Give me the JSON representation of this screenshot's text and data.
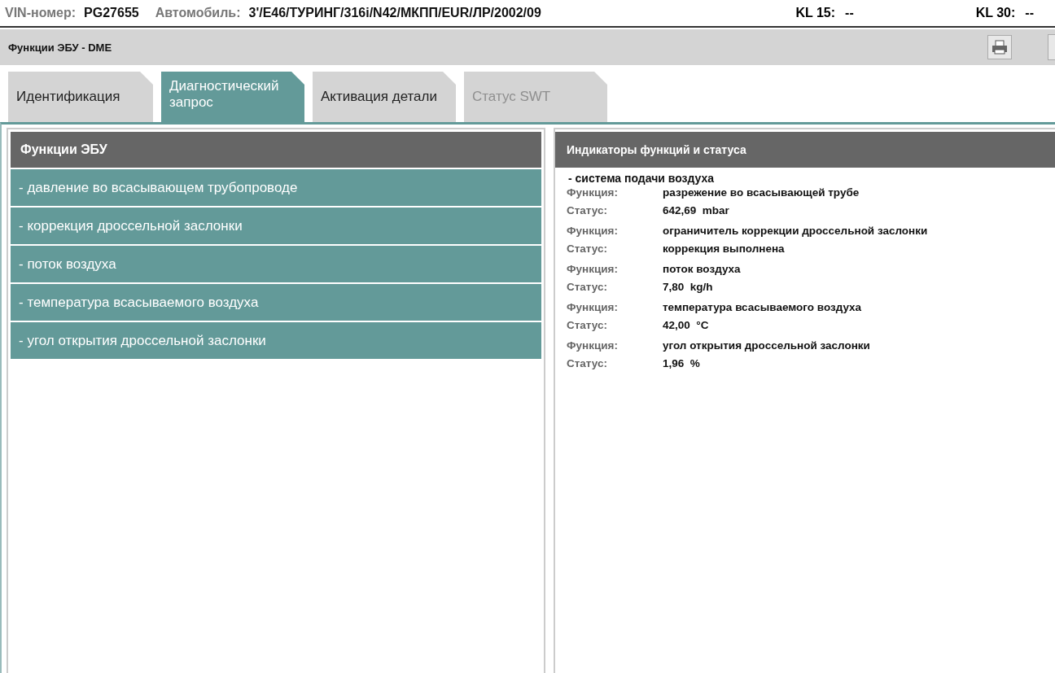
{
  "vehicle_bar": {
    "vin_label": "VIN-номер:",
    "vin": "PG27655",
    "car_label": "Автомобиль:",
    "car": "3'/E46/ТУРИНГ/316i/N42/МКПП/EUR/ЛР/2002/09",
    "kl15_label": "KL 15:",
    "kl15": "--",
    "kl30_label": "KL 30:",
    "kl30": "--"
  },
  "title_bar": {
    "title": "Функции ЭБУ - DME"
  },
  "tabs": [
    {
      "label": "Идентификация",
      "selected": false,
      "disabled": false
    },
    {
      "label": "Диагностический запрос",
      "selected": true,
      "disabled": false
    },
    {
      "label": "Активация детали",
      "selected": false,
      "disabled": false
    },
    {
      "label": "Статус SWT",
      "selected": false,
      "disabled": true
    }
  ],
  "functions_panel": {
    "title": "Функции ЭБУ",
    "items": [
      {
        "label": "- давление во всасывающем трубопроводе",
        "selected": true
      },
      {
        "label": "- коррекция дроссельной заслонки",
        "selected": true
      },
      {
        "label": "- поток воздуха",
        "selected": true
      },
      {
        "label": "- температура всасываемого воздуха",
        "selected": true
      },
      {
        "label": "- угол открытия дроссельной заслонки",
        "selected": true
      }
    ]
  },
  "status_panel": {
    "title": "Индикаторы функций и статуса",
    "group": "- система подачи воздуха",
    "entries": [
      {
        "function_label": "Функция:",
        "function": "разрежение во всасывающей трубе",
        "status_label": "Статус:",
        "status": "642,69  mbar"
      },
      {
        "function_label": "Функция:",
        "function": "ограничитель коррекции дроссельной заслонки",
        "status_label": "Статус:",
        "status": "коррекция выполнена"
      },
      {
        "function_label": "Функция:",
        "function": "поток воздуха",
        "status_label": "Статус:",
        "status": "7,80  kg/h"
      },
      {
        "function_label": "Функция:",
        "function": "температура всасываемого воздуха",
        "status_label": "Статус:",
        "status": "42,00  °C"
      },
      {
        "function_label": "Функция:",
        "function": "угол открытия дроссельной заслонки",
        "status_label": "Статус:",
        "status": "1,96  %"
      }
    ]
  }
}
